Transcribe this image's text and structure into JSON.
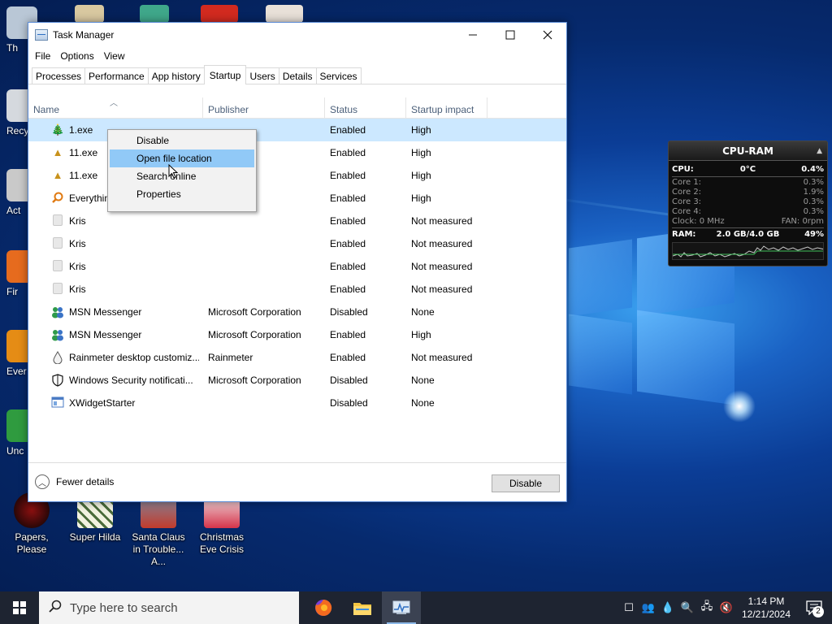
{
  "window": {
    "title": "Task Manager",
    "menu": [
      "File",
      "Options",
      "View"
    ],
    "tabs": [
      "Processes",
      "Performance",
      "App history",
      "Startup",
      "Users",
      "Details",
      "Services"
    ],
    "active_tab": "Startup",
    "columns": {
      "name": "Name",
      "publisher": "Publisher",
      "status": "Status",
      "impact": "Startup impact"
    },
    "rows": [
      {
        "icon": "tree-icon",
        "name": "1.exe",
        "publisher": "",
        "status": "Enabled",
        "impact": "High"
      },
      {
        "icon": "tree-icon",
        "name": "11.exe",
        "publisher": "",
        "status": "Enabled",
        "impact": "High"
      },
      {
        "icon": "tree-icon",
        "name": "11.exe",
        "publisher": "",
        "status": "Enabled",
        "impact": "High"
      },
      {
        "icon": "search-icon",
        "name": "Everything",
        "publisher": "",
        "status": "Enabled",
        "impact": "High"
      },
      {
        "icon": "generic-file-icon",
        "name": "Kris",
        "publisher": "",
        "status": "Enabled",
        "impact": "Not measured"
      },
      {
        "icon": "generic-file-icon",
        "name": "Kris",
        "publisher": "",
        "status": "Enabled",
        "impact": "Not measured"
      },
      {
        "icon": "generic-file-icon",
        "name": "Kris",
        "publisher": "",
        "status": "Enabled",
        "impact": "Not measured"
      },
      {
        "icon": "generic-file-icon",
        "name": "Kris",
        "publisher": "",
        "status": "Enabled",
        "impact": "Not measured"
      },
      {
        "icon": "msn-icon",
        "name": "MSN Messenger",
        "publisher": "Microsoft Corporation",
        "status": "Disabled",
        "impact": "None"
      },
      {
        "icon": "msn-icon",
        "name": "MSN Messenger",
        "publisher": "Microsoft Corporation",
        "status": "Enabled",
        "impact": "High"
      },
      {
        "icon": "rainmeter-icon",
        "name": "Rainmeter desktop customiz...",
        "publisher": "Rainmeter",
        "status": "Enabled",
        "impact": "Not measured"
      },
      {
        "icon": "shield-icon",
        "name": "Windows Security notificati...",
        "publisher": "Microsoft Corporation",
        "status": "Disabled",
        "impact": "None"
      },
      {
        "icon": "xwidget-icon",
        "name": "XWidgetStarter",
        "publisher": "",
        "status": "Disabled",
        "impact": "None"
      }
    ],
    "footer": {
      "fewer_details": "Fewer details",
      "disable_button": "Disable"
    }
  },
  "context_menu": {
    "items": [
      "Disable",
      "Open file location",
      "Search online",
      "Properties"
    ],
    "highlighted": "Open file location"
  },
  "widget": {
    "title": "CPU-RAM",
    "cpu_label": "CPU:",
    "cpu_temp": "0°C",
    "cpu_value": "0.4%",
    "cores": [
      {
        "label": "Core 1:",
        "value": "0.3%"
      },
      {
        "label": "Core 2:",
        "value": "1.9%"
      },
      {
        "label": "Core 3:",
        "value": "0.3%"
      },
      {
        "label": "Core 4:",
        "value": "0.3%"
      }
    ],
    "clock": "Clock: 0 MHz",
    "fan": "FAN: 0rpm",
    "ram_label": "RAM:",
    "ram_usage": "2.0 GB/4.0 GB",
    "ram_percent": "49%"
  },
  "desktop_icons": [
    {
      "label": "Papers, Please"
    },
    {
      "label": "Super Hilda"
    },
    {
      "label": "Santa Claus in Trouble... A..."
    },
    {
      "label": "Christmas Eve Crisis"
    }
  ],
  "desktop_left_labels": [
    "Th",
    "Recy",
    "Act",
    "Fir",
    "Ever",
    "Unc"
  ],
  "taskbar": {
    "search_placeholder": "Type here to search",
    "time": "1:14 PM",
    "date": "12/21/2024",
    "notification_count": "2"
  }
}
